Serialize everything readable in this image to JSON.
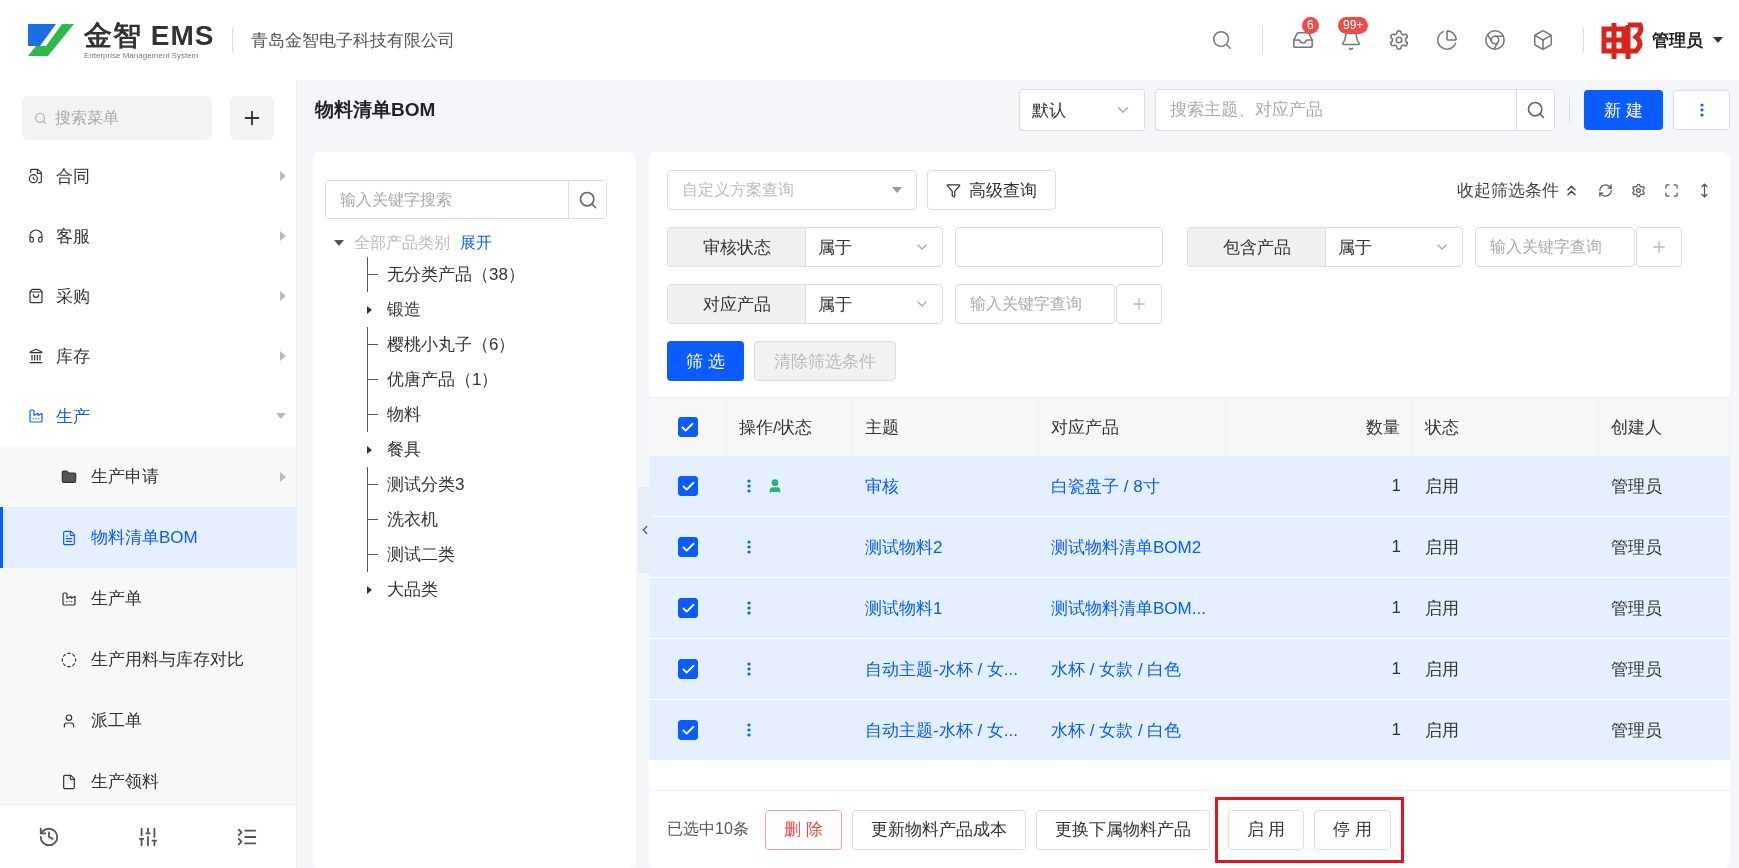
{
  "header": {
    "logo_text": "金智 EMS",
    "logo_subtitle": "Enterprise Management System",
    "company": "青岛金智电子科技有限公司",
    "icons": [
      {
        "kind": "inbox",
        "badge": "6"
      },
      {
        "kind": "bell",
        "badge": "99+"
      },
      {
        "kind": "settings"
      },
      {
        "kind": "pie"
      },
      {
        "kind": "chrome"
      },
      {
        "kind": "cube"
      }
    ],
    "user": "管理员"
  },
  "sidebar": {
    "search_placeholder": "搜索菜单",
    "items": [
      {
        "label": "合同",
        "expanded": false,
        "active": false
      },
      {
        "label": "客服",
        "expanded": false,
        "active": false
      },
      {
        "label": "采购",
        "expanded": false,
        "active": false
      },
      {
        "label": "库存",
        "expanded": false,
        "active": false
      },
      {
        "label": "生产",
        "expanded": true,
        "active": true,
        "children": [
          {
            "label": "生产申请",
            "has_arrow": true,
            "selected": false
          },
          {
            "label": "物料清单BOM",
            "has_arrow": false,
            "selected": true
          },
          {
            "label": "生产单",
            "has_arrow": false,
            "selected": false
          },
          {
            "label": "生产用料与库存对比",
            "has_arrow": false,
            "selected": false
          },
          {
            "label": "派工单",
            "has_arrow": false,
            "selected": false
          },
          {
            "label": "生产领料",
            "has_arrow": false,
            "selected": false
          }
        ]
      }
    ]
  },
  "toolbar": {
    "title": "物料清单BOM",
    "view": "默认",
    "search_placeholder": "搜索主题、对应产品",
    "new_button": "新 建"
  },
  "tree": {
    "search_placeholder": "输入关键字搜索",
    "root": {
      "label": "全部产品类别",
      "link": "展开",
      "expanded": true
    },
    "children": [
      {
        "label": "无分类产品（38）",
        "expandable": false
      },
      {
        "label": "锻造",
        "expandable": true
      },
      {
        "label": "樱桃小丸子（6）",
        "expandable": false
      },
      {
        "label": "优唐产品（1）",
        "expandable": false
      },
      {
        "label": "物料",
        "expandable": false
      },
      {
        "label": "餐具",
        "expandable": true
      },
      {
        "label": "测试分类3",
        "expandable": false
      },
      {
        "label": "洗衣机",
        "expandable": false
      },
      {
        "label": "测试二类",
        "expandable": false
      },
      {
        "label": "大品类",
        "expandable": true
      }
    ]
  },
  "filters": {
    "scheme_placeholder": "自定义方案查询",
    "advanced": "高级查询",
    "collapse": "收起筛选条件",
    "conditions": [
      {
        "label": "审核状态",
        "operator": "属于",
        "has_add": false
      },
      {
        "label": "包含产品",
        "operator": "属于",
        "placeholder": "输入关键字查询",
        "has_add": true
      },
      {
        "label": "对应产品",
        "operator": "属于",
        "placeholder": "输入关键字查询",
        "has_add": true
      }
    ],
    "apply": "筛 选",
    "clear": {
      "label": "清除筛选条件",
      "disabled": true
    }
  },
  "table": {
    "all_checked": true,
    "columns": [
      "操作/状态",
      "主题",
      "对应产品",
      "数量",
      "状态",
      "创建人"
    ],
    "rows": [
      {
        "selected": true,
        "audit_icon": true,
        "subject": "审核",
        "product": "白瓷盘子 / 8寸",
        "qty": "1",
        "status": "启用",
        "creator": "管理员"
      },
      {
        "selected": true,
        "audit_icon": false,
        "subject": "测试物料2",
        "product": "测试物料清单BOM2",
        "qty": "1",
        "status": "启用",
        "creator": "管理员"
      },
      {
        "selected": true,
        "audit_icon": false,
        "subject": "测试物料1",
        "product": "测试物料清单BOM...",
        "qty": "1",
        "status": "启用",
        "creator": "管理员"
      },
      {
        "selected": true,
        "audit_icon": false,
        "subject": "自动主题-水杯 / 女...",
        "product": "水杯 / 女款 / 白色",
        "qty": "1",
        "status": "启用",
        "creator": "管理员"
      },
      {
        "selected": true,
        "audit_icon": false,
        "subject": "自动主题-水杯 / 女...",
        "product": "水杯 / 女款 / 白色",
        "qty": "1",
        "status": "启用",
        "creator": "管理员"
      }
    ]
  },
  "bulk": {
    "count": "已选中10条",
    "buttons": [
      {
        "label": "删 除",
        "kind": "danger"
      },
      {
        "label": "更新物料产品成本",
        "kind": "default"
      },
      {
        "label": "更换下属物料产品",
        "kind": "default"
      }
    ],
    "highlight_box": {
      "buttons": [
        {
          "label": "启 用",
          "kind": "default"
        },
        {
          "label": "停 用",
          "kind": "default"
        }
      ]
    }
  }
}
